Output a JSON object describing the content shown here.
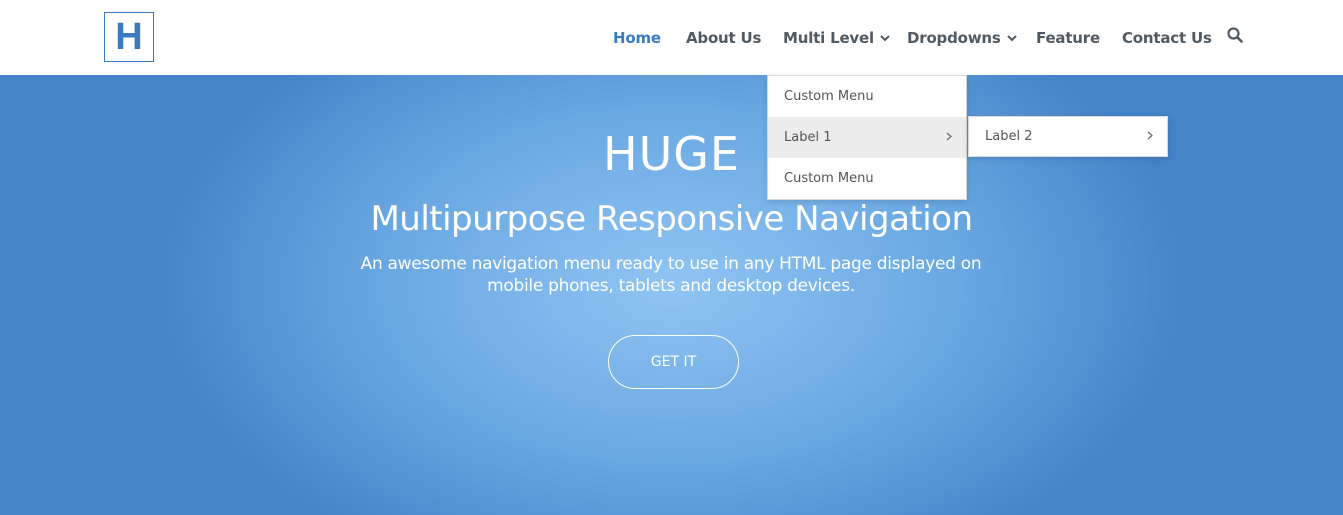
{
  "logo": {
    "text": "H",
    "color": "#3a7abf"
  },
  "nav": {
    "items": [
      {
        "label": "Home",
        "active": true
      },
      {
        "label": "About Us"
      },
      {
        "label": "Multi Level",
        "icon": "chevron-down-icon"
      },
      {
        "label": "Dropdowns",
        "icon": "chevron-down-icon"
      },
      {
        "label": "Feature"
      },
      {
        "label": "Contact Us"
      }
    ],
    "search_icon": "search-icon"
  },
  "dropdown": {
    "items": [
      {
        "label": "Custom Menu"
      },
      {
        "label": "Label 1",
        "icon": "chevron-right-icon",
        "hover": true
      },
      {
        "label": "Custom Menu"
      }
    ],
    "submenu": {
      "items": [
        {
          "label": "Label 2",
          "icon": "chevron-right-icon"
        }
      ]
    }
  },
  "hero": {
    "title": "HUGE",
    "subtitle": "Multipurpose Responsive Navigation",
    "description": "An awesome navigation menu ready to use in any HTML page displayed on mobile phones, tablets and desktop devices.",
    "cta_label": "GET IT"
  },
  "colors": {
    "accent": "#3a7abf",
    "hero_center": "#90c4f3",
    "hero_edge": "#4484c7",
    "nav_text": "#505a63"
  }
}
